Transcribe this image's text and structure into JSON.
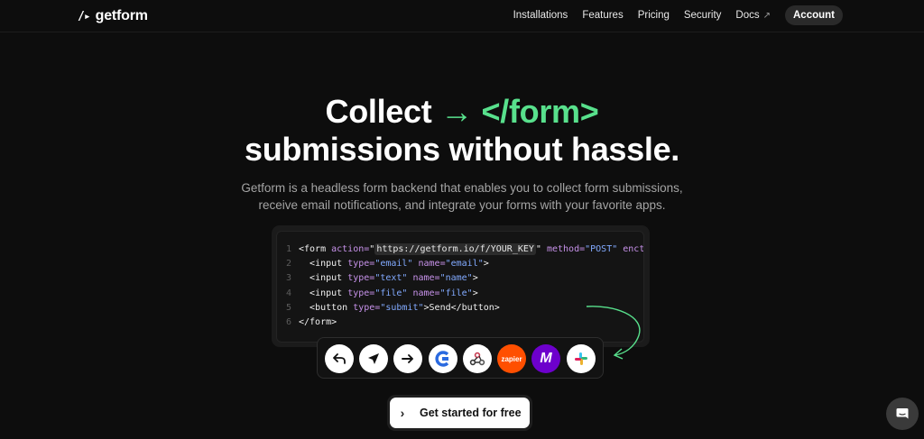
{
  "nav": {
    "logo_mark": "/▸",
    "logo_text": "getform",
    "links": [
      {
        "label": "Installations"
      },
      {
        "label": "Features"
      },
      {
        "label": "Pricing"
      },
      {
        "label": "Security"
      },
      {
        "label": "Docs",
        "external_icon": "↗"
      }
    ],
    "account_label": "Account"
  },
  "hero": {
    "title_line1_a": "Collect ",
    "title_arrow": "→",
    "title_line1_b": " </form>",
    "title_line2": "submissions without hassle.",
    "subtitle_line1": "Getform is a headless form backend that enables you to collect form submissions,",
    "subtitle_line2": "receive email notifications, and integrate your forms with your favorite apps."
  },
  "code": {
    "line_numbers": [
      "1",
      "2",
      "3",
      "4",
      "5",
      "6"
    ],
    "form_open": "<form ",
    "action_attr": "action=",
    "action_q1": "\"",
    "action_url": "https://getform.io/f/YOUR_KEY",
    "action_q2": "\"",
    "method_attr": " method=",
    "method_val": "\"POST\"",
    "enctype_attr": " enctype",
    "close_bracket": ">",
    "input_open": "<input ",
    "type_attr": "type=",
    "name_attr": " name=",
    "email_type": "\"email\"",
    "email_name": "\"email\"",
    "text_type": "\"text\"",
    "text_name": "\"name\"",
    "file_type": "\"file\"",
    "file_name": "\"file\"",
    "button_open": "<button ",
    "submit_type": "\"submit\"",
    "button_text": "Send",
    "button_close": "</button>",
    "form_close": "</form>"
  },
  "integrations": [
    {
      "icon": "reply-icon"
    },
    {
      "icon": "send-icon"
    },
    {
      "icon": "arrow-right-icon"
    },
    {
      "icon": "google-sheets-logo-icon"
    },
    {
      "icon": "webhook-icon"
    },
    {
      "icon": "zapier-logo-icon",
      "label": "zapier"
    },
    {
      "icon": "make-logo-icon",
      "label": "M"
    },
    {
      "icon": "slack-logo-icon"
    }
  ],
  "cta": {
    "chevron": "›",
    "label": "Get started for free"
  },
  "colors": {
    "accent_green": "#58e08c",
    "background": "#0d0d0d",
    "zapier": "#ff4f00",
    "make": "#6d00cc"
  }
}
